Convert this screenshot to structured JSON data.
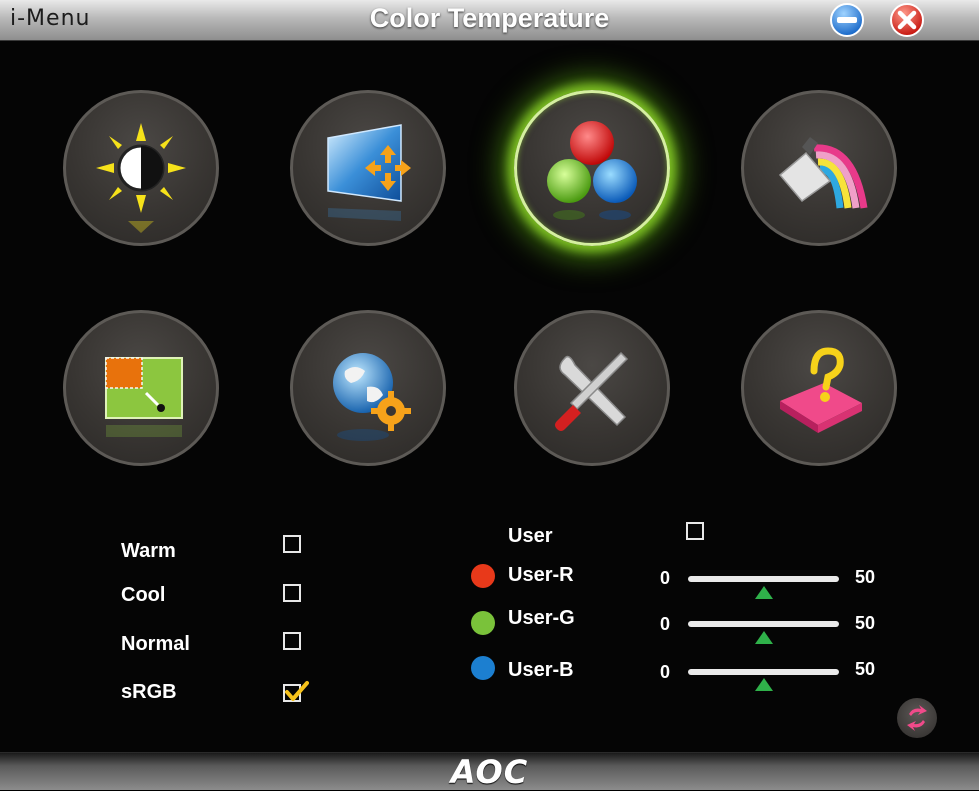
{
  "window": {
    "app_name": "i-Menu",
    "title": "Color Temperature",
    "minimize_icon": "minimize-icon",
    "close_icon": "close-icon"
  },
  "menu_icons": [
    {
      "name": "luminance",
      "icon": "sun-contrast-icon",
      "active": false
    },
    {
      "name": "image-setup",
      "icon": "screen-move-icon",
      "active": false
    },
    {
      "name": "color-temperature",
      "icon": "rgb-balls-icon",
      "active": true
    },
    {
      "name": "color-boost",
      "icon": "paint-rainbow-icon",
      "active": false
    },
    {
      "name": "picture-boost",
      "icon": "picture-frame-icon",
      "active": false
    },
    {
      "name": "osd-setup",
      "icon": "globe-gear-icon",
      "active": false
    },
    {
      "name": "extra",
      "icon": "tools-icon",
      "active": false
    },
    {
      "name": "help",
      "icon": "question-icon",
      "active": false
    }
  ],
  "presets": [
    {
      "label": "Warm",
      "checked": false
    },
    {
      "label": "Cool",
      "checked": false
    },
    {
      "label": "Normal",
      "checked": false
    },
    {
      "label": "sRGB",
      "checked": true
    }
  ],
  "user": {
    "label": "User",
    "checked": false,
    "channels": [
      {
        "label": "User-R",
        "color": "#e8391a",
        "min": "0",
        "max": "50",
        "value": 0.5
      },
      {
        "label": "User-G",
        "color": "#7ac23a",
        "min": "0",
        "max": "50",
        "value": 0.5
      },
      {
        "label": "User-B",
        "color": "#1c7fd0",
        "min": "0",
        "max": "50",
        "value": 0.5
      }
    ]
  },
  "reset_icon": "reset-icon",
  "footer": {
    "logo": "AOC"
  }
}
